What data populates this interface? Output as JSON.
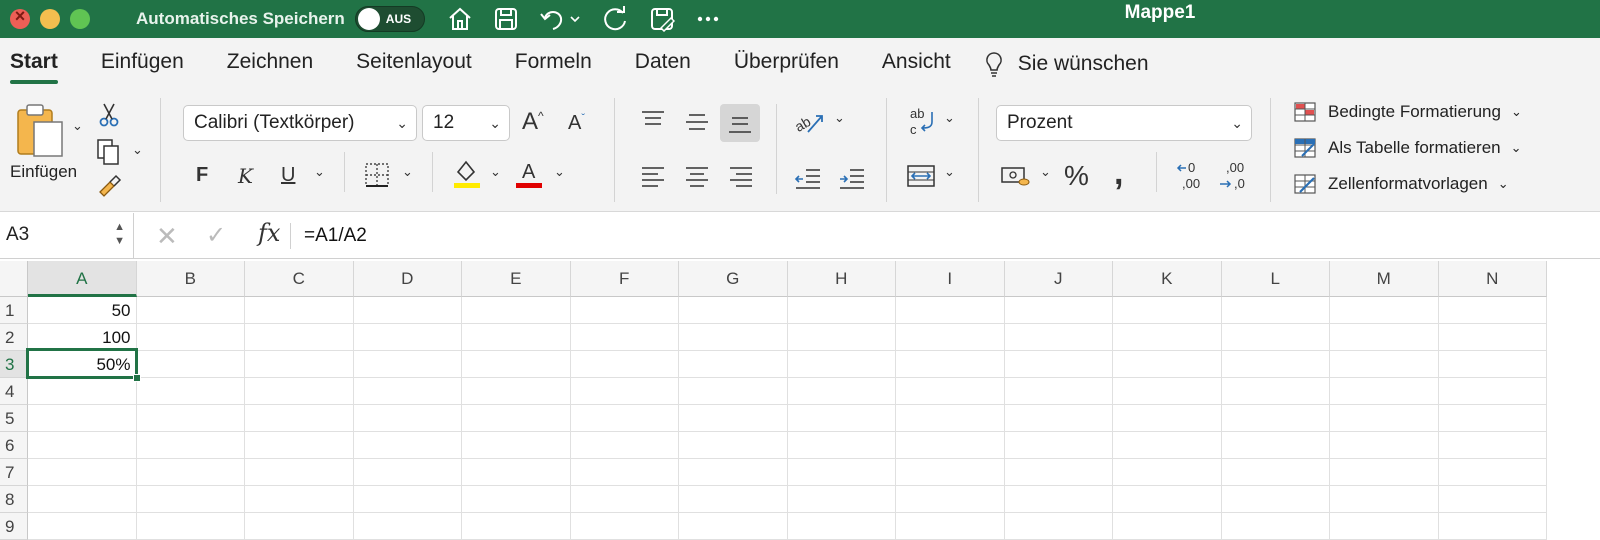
{
  "titlebar": {
    "autosave_label": "Automatisches Speichern",
    "toggle_state": "AUS",
    "doc_title": "Mappe1",
    "quick_access": [
      "home-icon",
      "save-icon",
      "undo-icon",
      "redo-icon",
      "sync-icon",
      "more-icon"
    ]
  },
  "tabs": [
    {
      "label": "Start",
      "active": true
    },
    {
      "label": "Einfügen"
    },
    {
      "label": "Zeichnen"
    },
    {
      "label": "Seitenlayout"
    },
    {
      "label": "Formeln"
    },
    {
      "label": "Daten"
    },
    {
      "label": "Überprüfen"
    },
    {
      "label": "Ansicht"
    }
  ],
  "tell_me": "Sie wünschen",
  "ribbon": {
    "paste_label": "Einfügen",
    "font_name": "Calibri (Textkörper)",
    "font_size": "12",
    "bold": "F",
    "italic": "K",
    "underline": "U",
    "number_format": "Prozent",
    "percent": "%",
    "comma": ",",
    "styles": [
      {
        "label": "Bedingte Formatierung",
        "icon": "conditional-formatting-icon"
      },
      {
        "label": "Als Tabelle formatieren",
        "icon": "format-as-table-icon"
      },
      {
        "label": "Zellenformatvorlagen",
        "icon": "cell-styles-icon"
      }
    ],
    "colors": {
      "highlight": "#ffeb00",
      "font_color": "#e00000",
      "accent": "#217346"
    }
  },
  "formula_bar": {
    "name_box": "A3",
    "fx": "fx",
    "formula": "=A1/A2"
  },
  "grid": {
    "columns": [
      "A",
      "B",
      "C",
      "D",
      "E",
      "F",
      "G",
      "H",
      "I",
      "J",
      "K",
      "L",
      "M",
      "N"
    ],
    "rows": [
      "1",
      "2",
      "3",
      "4",
      "5",
      "6",
      "7",
      "8",
      "9"
    ],
    "cells": {
      "A1": "50",
      "A2": "100",
      "A3": "50%"
    },
    "selected": "A3"
  }
}
